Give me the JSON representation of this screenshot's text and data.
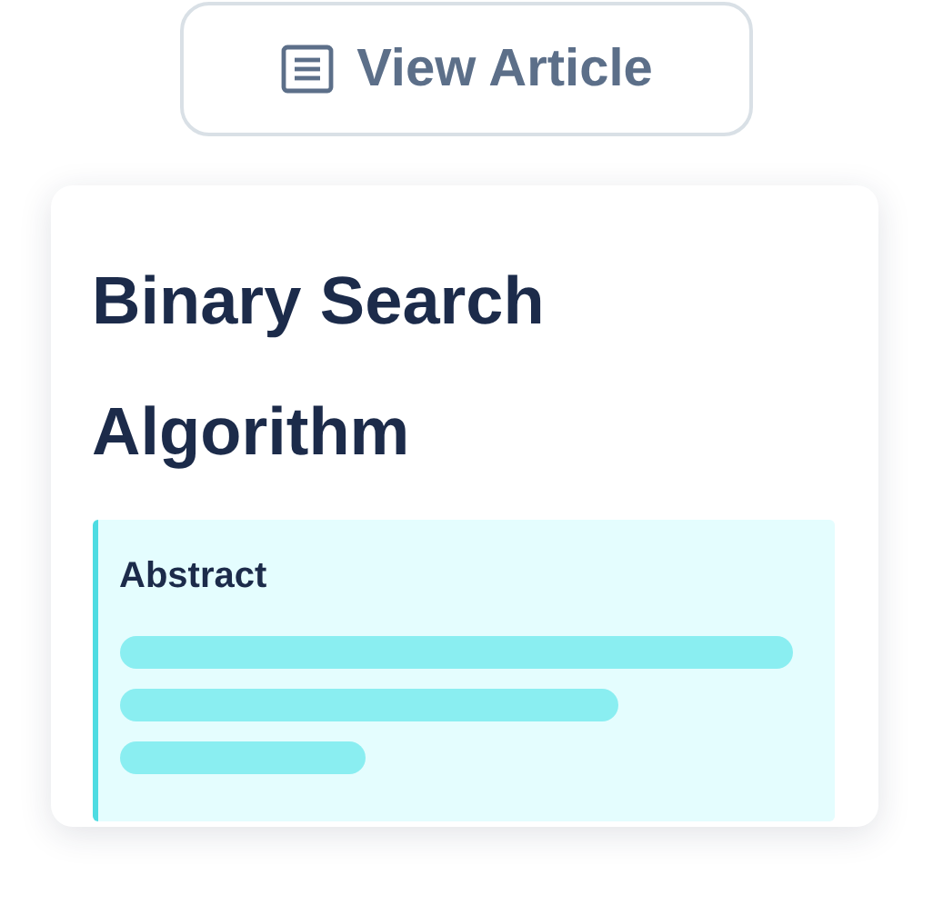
{
  "button": {
    "label": "View Article"
  },
  "card": {
    "title": "Binary Search Algorithm",
    "abstract": {
      "heading": "Abstract"
    }
  }
}
